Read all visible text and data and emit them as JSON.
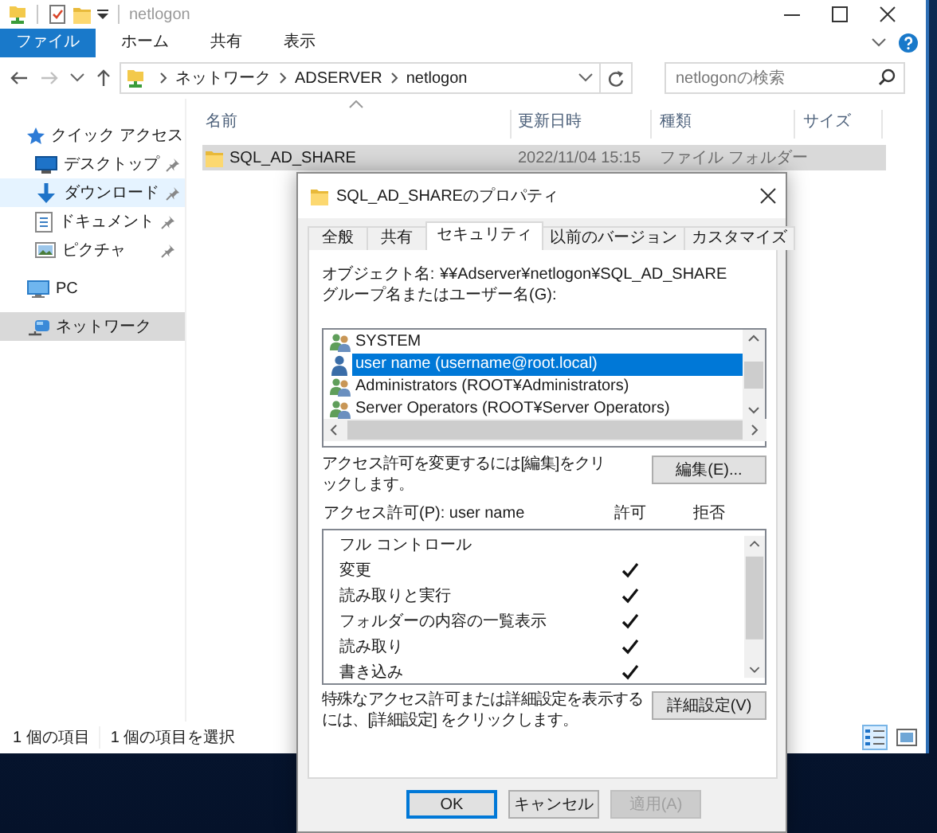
{
  "window": {
    "title": "netlogon"
  },
  "ribbon_tabs": [
    {
      "label": "ファイル",
      "kind": "file"
    },
    {
      "label": "ホーム",
      "kind": "tab"
    },
    {
      "label": "共有",
      "kind": "tab"
    },
    {
      "label": "表示",
      "kind": "tab"
    }
  ],
  "address_bar": {
    "path": [
      "ネットワーク",
      "ADSERVER",
      "netlogon"
    ]
  },
  "search": {
    "placeholder": "netlogonの検索"
  },
  "sidebar": {
    "items": [
      {
        "label": "クイック アクセス",
        "kind": "quick_access",
        "selected": false,
        "highlighted": false,
        "children": [
          {
            "label": "デスクトップ",
            "kind": "desktop",
            "pinned": true,
            "selected": false,
            "highlighted": false
          },
          {
            "label": "ダウンロード",
            "kind": "downloads",
            "pinned": true,
            "selected": false,
            "highlighted": true
          },
          {
            "label": "ドキュメント",
            "kind": "documents",
            "pinned": true,
            "selected": false,
            "highlighted": false
          },
          {
            "label": "ピクチャ",
            "kind": "pictures",
            "pinned": true,
            "selected": false,
            "highlighted": false
          }
        ]
      },
      {
        "label": "PC",
        "kind": "pc",
        "selected": false,
        "highlighted": false
      },
      {
        "label": "ネットワーク",
        "kind": "network",
        "selected": true,
        "highlighted": false
      }
    ]
  },
  "table": {
    "columns": [
      {
        "label": "名前",
        "sorted": true
      },
      {
        "label": "更新日時",
        "sorted": false
      },
      {
        "label": "種類",
        "sorted": false
      },
      {
        "label": "サイズ",
        "sorted": false
      }
    ],
    "rows": [
      {
        "name": "SQL_AD_SHARE",
        "modified": "2022/11/04 15:15",
        "type": "ファイル フォルダー",
        "selected": true
      }
    ]
  },
  "status_bar": {
    "item_count": "1 個の項目",
    "selection": "1 個の項目を選択",
    "views": [
      {
        "kind": "details",
        "selected": true
      },
      {
        "kind": "large_icons",
        "selected": false
      }
    ]
  },
  "dialog": {
    "title": "SQL_AD_SHAREのプロパティ",
    "tabs": [
      {
        "label": "全般",
        "selected": false
      },
      {
        "label": "共有",
        "selected": false
      },
      {
        "label": "セキュリティ",
        "selected": true
      },
      {
        "label": "以前のバージョン",
        "selected": false
      },
      {
        "label": "カスタマイズ",
        "selected": false
      }
    ],
    "object_label": "オブジェクト名:",
    "object_value": "¥¥Adserver¥netlogon¥SQL_AD_SHARE",
    "group_label": "グループ名またはユーザー名(G):",
    "principals": [
      {
        "name": "SYSTEM",
        "kind": "group",
        "selected": false
      },
      {
        "name": "user name (username@root.local)",
        "kind": "user",
        "selected": true
      },
      {
        "name": "Administrators (ROOT¥Administrators)",
        "kind": "group",
        "selected": false
      },
      {
        "name": "Server Operators (ROOT¥Server Operators)",
        "kind": "group",
        "selected": false
      }
    ],
    "edit_hint": "アクセス許可を変更するには[編集]をクリックします。",
    "edit_button": "編集(E)...",
    "permissions_label": "アクセス許可(P): user name",
    "allow_header": "許可",
    "deny_header": "拒否",
    "permissions": [
      {
        "name": "フル コントロール",
        "allow": false,
        "deny": false
      },
      {
        "name": "変更",
        "allow": true,
        "deny": false
      },
      {
        "name": "読み取りと実行",
        "allow": true,
        "deny": false
      },
      {
        "name": "フォルダーの内容の一覧表示",
        "allow": true,
        "deny": false
      },
      {
        "name": "読み取り",
        "allow": true,
        "deny": false
      },
      {
        "name": "書き込み",
        "allow": true,
        "deny": false
      }
    ],
    "advanced_hint": "特殊なアクセス許可または詳細設定を表示するには、[詳細設定] をクリックします。",
    "advanced_button": "詳細設定(V)",
    "buttons": [
      {
        "label": "OK",
        "default": true,
        "disabled": false
      },
      {
        "label": "キャンセル",
        "default": false,
        "disabled": false
      },
      {
        "label": "適用(A)",
        "default": false,
        "disabled": true
      }
    ]
  }
}
